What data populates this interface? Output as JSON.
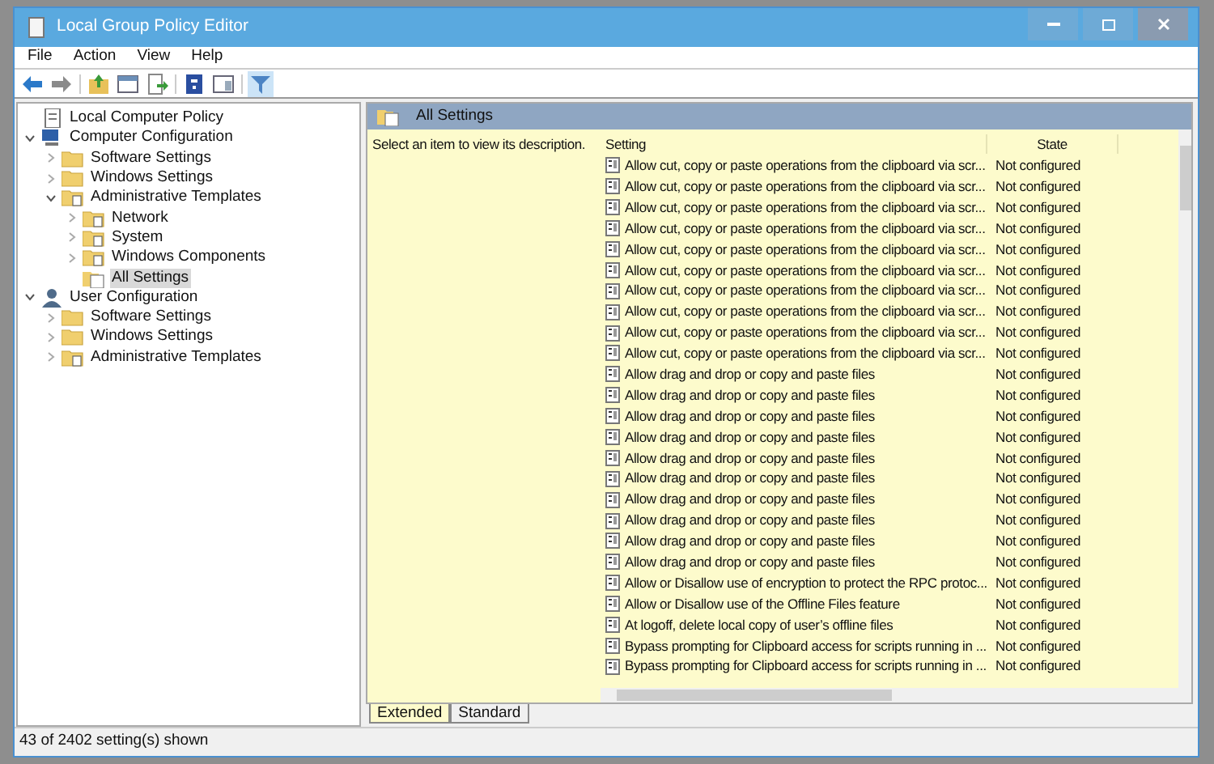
{
  "window": {
    "title": "Local Group Policy Editor"
  },
  "menu": [
    "File",
    "Action",
    "View",
    "Help"
  ],
  "toolbar": [
    {
      "kind": "back",
      "pressed": false
    },
    {
      "kind": "forward",
      "pressed": false
    },
    {
      "kind": "up",
      "pressed": false
    },
    {
      "kind": "tree",
      "pressed": false
    },
    {
      "kind": "export",
      "pressed": false
    },
    {
      "kind": "help",
      "pressed": false
    },
    {
      "kind": "pane",
      "pressed": false
    },
    {
      "kind": "filter",
      "pressed": true
    }
  ],
  "tree": [
    {
      "label": "Local Computer Policy",
      "kind": "policy",
      "selected": false,
      "children": [
        {
          "label": "Computer Configuration",
          "kind": "computer",
          "expanded": true,
          "selected": false,
          "children": [
            {
              "label": "Software Settings",
              "kind": "folder",
              "expanded": false,
              "selected": false
            },
            {
              "label": "Windows Settings",
              "kind": "folder",
              "expanded": false,
              "selected": false
            },
            {
              "label": "Administrative Templates",
              "kind": "template",
              "expanded": true,
              "selected": false,
              "children": [
                {
                  "label": "Network",
                  "kind": "template",
                  "expanded": false,
                  "selected": false
                },
                {
                  "label": "System",
                  "kind": "template",
                  "expanded": false,
                  "selected": false
                },
                {
                  "label": "Windows Components",
                  "kind": "template",
                  "expanded": false,
                  "selected": false
                },
                {
                  "label": "All Settings",
                  "kind": "settings",
                  "selected": true
                }
              ]
            }
          ]
        },
        {
          "label": "User Configuration",
          "kind": "user",
          "expanded": true,
          "selected": false,
          "children": [
            {
              "label": "Software Settings",
              "kind": "folder",
              "expanded": false,
              "selected": false
            },
            {
              "label": "Windows Settings",
              "kind": "folder",
              "expanded": false,
              "selected": false
            },
            {
              "label": "Administrative Templates",
              "kind": "template",
              "expanded": false,
              "selected": false
            }
          ]
        }
      ]
    }
  ],
  "pane": {
    "title": "All Settings",
    "description": "Select an item to view its description."
  },
  "table": {
    "columns": [
      "Setting",
      "State"
    ],
    "rows": [
      {
        "setting": "Allow cut, copy or paste operations from the clipboard via scr...",
        "state": "Not configured"
      },
      {
        "setting": "Allow cut, copy or paste operations from the clipboard via scr...",
        "state": "Not configured"
      },
      {
        "setting": "Allow cut, copy or paste operations from the clipboard via scr...",
        "state": "Not configured"
      },
      {
        "setting": "Allow cut, copy or paste operations from the clipboard via scr...",
        "state": "Not configured"
      },
      {
        "setting": "Allow cut, copy or paste operations from the clipboard via scr...",
        "state": "Not configured"
      },
      {
        "setting": "Allow cut, copy or paste operations from the clipboard via scr...",
        "state": "Not configured"
      },
      {
        "setting": "Allow cut, copy or paste operations from the clipboard via scr...",
        "state": "Not configured"
      },
      {
        "setting": "Allow cut, copy or paste operations from the clipboard via scr...",
        "state": "Not configured"
      },
      {
        "setting": "Allow cut, copy or paste operations from the clipboard via scr...",
        "state": "Not configured"
      },
      {
        "setting": "Allow cut, copy or paste operations from the clipboard via scr...",
        "state": "Not configured"
      },
      {
        "setting": "Allow drag and drop or copy and paste files",
        "state": "Not configured"
      },
      {
        "setting": "Allow drag and drop or copy and paste files",
        "state": "Not configured"
      },
      {
        "setting": "Allow drag and drop or copy and paste files",
        "state": "Not configured"
      },
      {
        "setting": "Allow drag and drop or copy and paste files",
        "state": "Not configured"
      },
      {
        "setting": "Allow drag and drop or copy and paste files",
        "state": "Not configured"
      },
      {
        "setting": "Allow drag and drop or copy and paste files",
        "state": "Not configured"
      },
      {
        "setting": "Allow drag and drop or copy and paste files",
        "state": "Not configured"
      },
      {
        "setting": "Allow drag and drop or copy and paste files",
        "state": "Not configured"
      },
      {
        "setting": "Allow drag and drop or copy and paste files",
        "state": "Not configured"
      },
      {
        "setting": "Allow drag and drop or copy and paste files",
        "state": "Not configured"
      },
      {
        "setting": "Allow or Disallow use of encryption to protect the RPC protoc...",
        "state": "Not configured"
      },
      {
        "setting": "Allow or Disallow use of the Offline Files feature",
        "state": "Not configured"
      },
      {
        "setting": "At logoff, delete local copy of user’s offline files",
        "state": "Not configured"
      },
      {
        "setting": "Bypass prompting for Clipboard access for scripts running in ...",
        "state": "Not configured"
      },
      {
        "setting": "Bypass prompting for Clipboard access for scripts running in ...",
        "state": "Not configured"
      }
    ]
  },
  "view_tabs": [
    {
      "label": "Extended",
      "selected": true
    },
    {
      "label": "Standard",
      "selected": false
    }
  ],
  "status_bar": "43 of 2402 setting(s) shown"
}
